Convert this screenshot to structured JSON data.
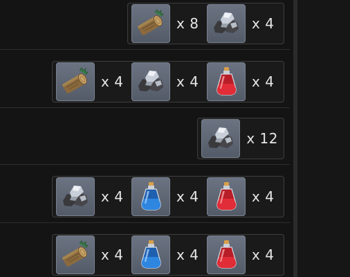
{
  "rows": [
    {
      "items": [
        {
          "icon": "wood-log-icon",
          "qty": "x 8"
        },
        {
          "icon": "iron-ore-icon",
          "qty": "x 4"
        }
      ]
    },
    {
      "items": [
        {
          "icon": "wood-log-icon",
          "qty": "x 4"
        },
        {
          "icon": "iron-ore-icon",
          "qty": "x 4"
        },
        {
          "icon": "red-potion-icon",
          "qty": "x 4"
        }
      ]
    },
    {
      "items": [
        {
          "icon": "iron-ore-icon",
          "qty": "x 12"
        }
      ]
    },
    {
      "items": [
        {
          "icon": "iron-ore-icon",
          "qty": "x 4"
        },
        {
          "icon": "blue-potion-icon",
          "qty": "x 4"
        },
        {
          "icon": "red-potion-icon",
          "qty": "x 4"
        }
      ]
    },
    {
      "items": [
        {
          "icon": "wood-log-icon",
          "qty": "x 4"
        },
        {
          "icon": "blue-potion-icon",
          "qty": "x 4"
        },
        {
          "icon": "red-potion-icon",
          "qty": "x 4"
        }
      ]
    }
  ],
  "colors": {
    "background": "#141414",
    "slot": "#606775",
    "text": "#e6e6e6",
    "potion_red": "#e02d37",
    "potion_blue": "#2f86e0"
  }
}
